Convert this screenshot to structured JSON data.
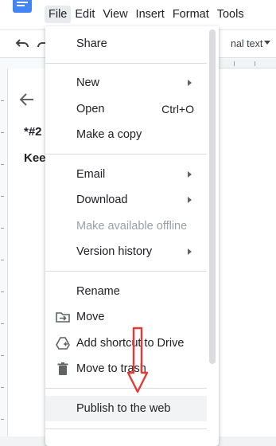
{
  "menubar": {
    "items": [
      "File",
      "Edit",
      "View",
      "Insert",
      "Format",
      "Tools"
    ]
  },
  "toolbar": {
    "undo_icon": "undo-icon",
    "redo_icon": "redo-icon",
    "style_label": "nal text"
  },
  "document": {
    "line1": "*#2",
    "line2": "Kee"
  },
  "file_menu": {
    "share": "Share",
    "new": "New",
    "open": "Open",
    "open_shortcut": "Ctrl+O",
    "make_copy": "Make a copy",
    "email": "Email",
    "download": "Download",
    "offline": "Make available offline",
    "version_history": "Version history",
    "rename": "Rename",
    "move": "Move",
    "add_shortcut": "Add shortcut to Drive",
    "move_trash": "Move to trash",
    "publish": "Publish to the web"
  },
  "colors": {
    "accent": "#4285f4",
    "annotation": "#e53935",
    "disabled_text": "#9aa0a6"
  }
}
